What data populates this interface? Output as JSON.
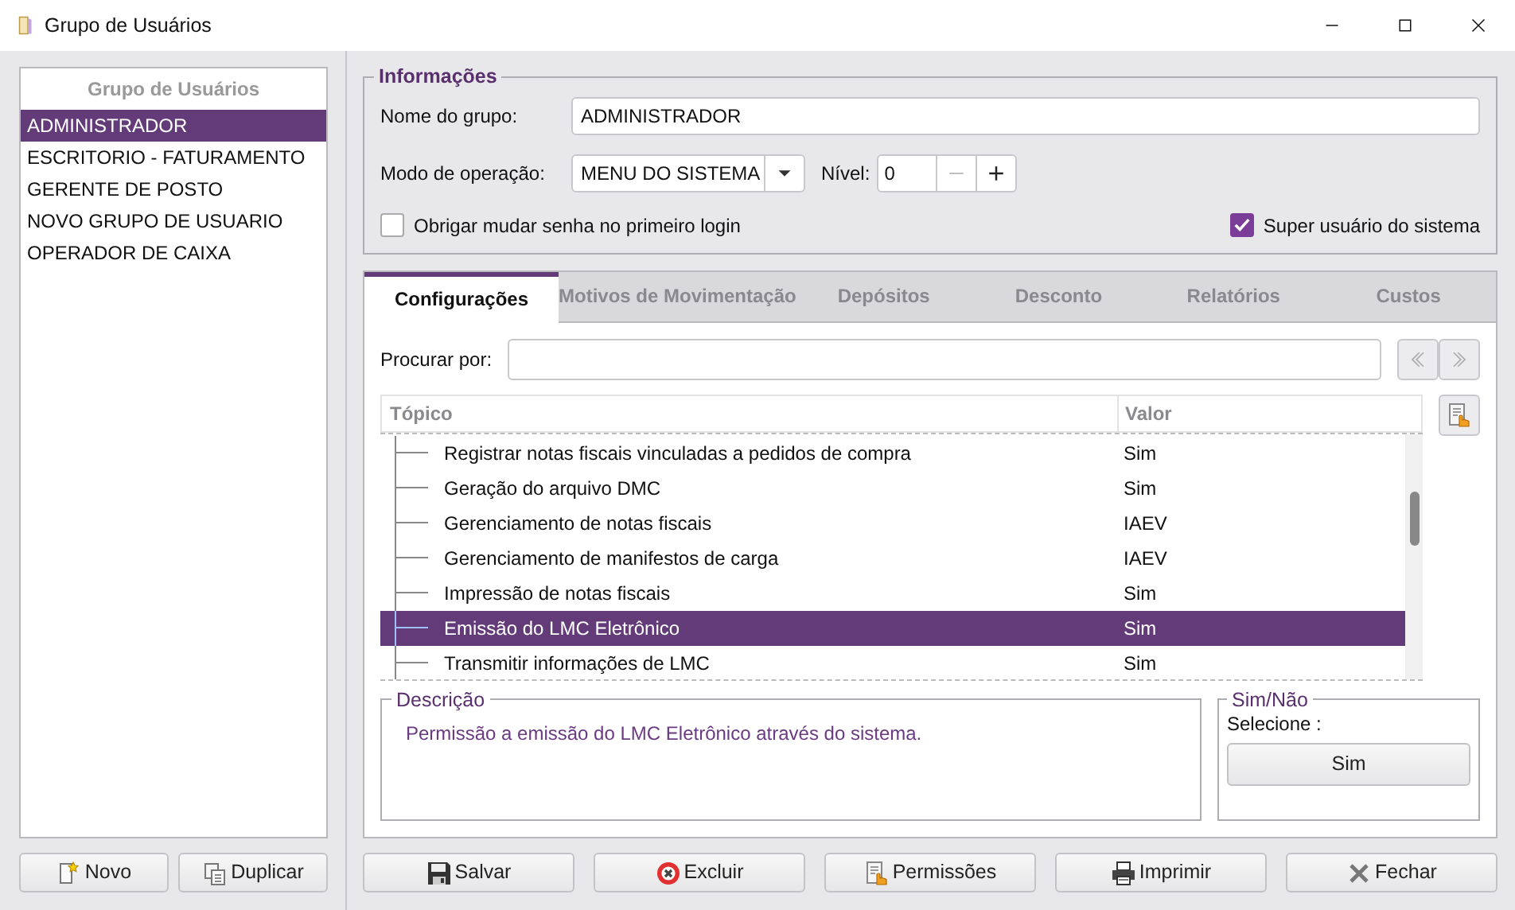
{
  "window": {
    "title": "Grupo de Usuários"
  },
  "groups": {
    "header": "Grupo de Usuários",
    "items": [
      {
        "label": "ADMINISTRADOR",
        "selected": true
      },
      {
        "label": "ESCRITORIO - FATURAMENTO",
        "selected": false
      },
      {
        "label": "GERENTE DE POSTO",
        "selected": false
      },
      {
        "label": "NOVO GRUPO DE USUARIO",
        "selected": false
      },
      {
        "label": "OPERADOR DE CAIXA",
        "selected": false
      }
    ]
  },
  "left_buttons": [
    {
      "label": "Novo",
      "kind": "new"
    },
    {
      "label": "Duplicar",
      "kind": "duplicate"
    }
  ],
  "info": {
    "legend": "Informações",
    "name_label": "Nome do grupo:",
    "name_value": "ADMINISTRADOR",
    "mode_label": "Modo de operação:",
    "mode_value": "MENU DO SISTEMA",
    "level_label": "Nível:",
    "level_value": "0",
    "force_password": {
      "label": "Obrigar mudar senha no primeiro login",
      "checked": false
    },
    "superuser": {
      "label": "Super usuário do sistema",
      "checked": true
    }
  },
  "tabs": [
    {
      "label": "Configurações",
      "selected": true
    },
    {
      "label": "Motivos de Movimentação",
      "selected": false
    },
    {
      "label": "Depósitos",
      "selected": false
    },
    {
      "label": "Desconto",
      "selected": false
    },
    {
      "label": "Relatórios",
      "selected": false
    },
    {
      "label": "Custos",
      "selected": false
    }
  ],
  "search": {
    "label": "Procurar por:"
  },
  "table": {
    "columns": [
      "Tópico",
      "Valor"
    ],
    "rows": [
      {
        "topic": "Registrar notas fiscais vinculadas a pedidos de compra",
        "value": "Sim",
        "selected": false
      },
      {
        "topic": "Geração do arquivo DMC",
        "value": "Sim",
        "selected": false
      },
      {
        "topic": "Gerenciamento de notas fiscais",
        "value": "IAEV",
        "selected": false
      },
      {
        "topic": "Gerenciamento de manifestos de carga",
        "value": "IAEV",
        "selected": false
      },
      {
        "topic": "Impressão de notas fiscais",
        "value": "Sim",
        "selected": false
      },
      {
        "topic": "Emissão do LMC Eletrônico",
        "value": "Sim",
        "selected": true
      },
      {
        "topic": "Transmitir informações de LMC",
        "value": "Sim",
        "selected": false
      }
    ]
  },
  "description": {
    "legend": "Descrição",
    "text": "Permissão a emissão do LMC Eletrônico através do sistema."
  },
  "yes_no": {
    "legend": "Sim/Não",
    "prompt": "Selecione :",
    "button": "Sim"
  },
  "buttons": [
    {
      "label": "Salvar",
      "kind": "save"
    },
    {
      "label": "Excluir",
      "kind": "delete"
    },
    {
      "label": "Permissões",
      "kind": "permissions"
    },
    {
      "label": "Imprimir",
      "kind": "print"
    },
    {
      "label": "Fechar",
      "kind": "close"
    }
  ]
}
